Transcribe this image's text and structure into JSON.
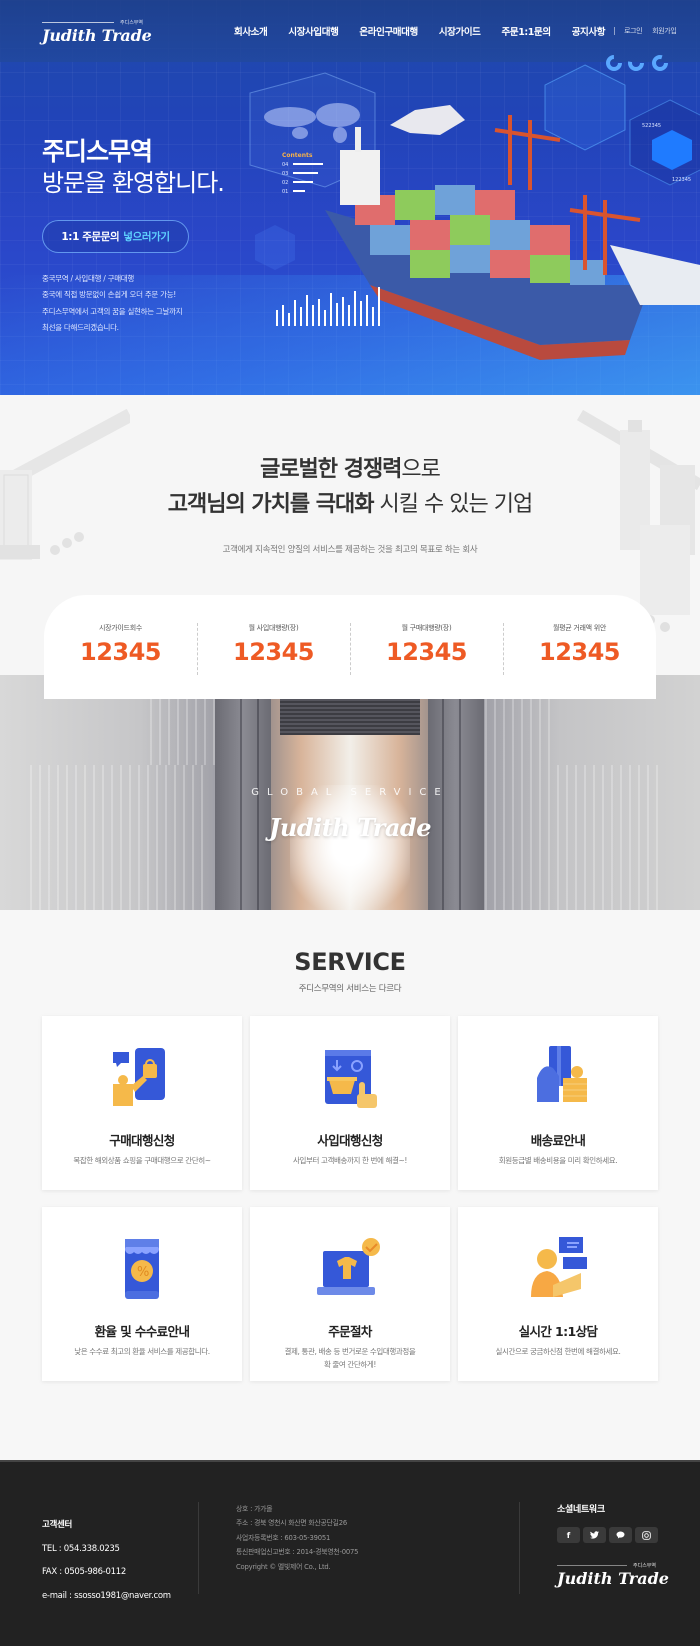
{
  "header": {
    "logo_text": "Judith Trade",
    "logo_sub": "주디스무역",
    "nav": [
      {
        "label": "회사소개"
      },
      {
        "label": "시장사입대행"
      },
      {
        "label": "온라인구매대행"
      },
      {
        "label": "시장가이드"
      },
      {
        "label": "주문1:1문의"
      },
      {
        "label": "공지사항"
      }
    ],
    "util": {
      "login": "로그인",
      "join": "회원가입"
    }
  },
  "hero": {
    "title_line1": "주디스무역",
    "title_line2": "방문을 환영합니다.",
    "cta_prefix": "1:1 주문문의",
    "cta_highlight": "넣으러가기",
    "desc": [
      "중국무역 / 사입대행 / 구매대행",
      "중국에 직접 방문없이 손쉽게 오더 주문 가능!",
      "주디스무역에서 고객의 꿈을 실현하는 그날까지",
      "최선을 다해드리겠습니다."
    ],
    "illustration": {
      "contents_label": "Contents",
      "contents_items": [
        "04",
        "03",
        "02",
        "01"
      ],
      "data_label_1": "522345",
      "data_label_2": "122345"
    }
  },
  "value": {
    "line1_bold": "글로벌한 경쟁력",
    "line1_rest": "으로",
    "line2_bold": "고객님의 가치를 극대화",
    "line2_rest": " 시킬 수 있는 기업",
    "subtitle": "고객에게 지속적인 양질의 서비스를 제공하는 것을 최고의 목표로 하는 회사"
  },
  "stats": [
    {
      "label": "시장가이드회수",
      "value": "12345"
    },
    {
      "label": "월 사입대행량(장)",
      "value": "12345"
    },
    {
      "label": "월 구매대행량(장)",
      "value": "12345"
    },
    {
      "label": "월평균 거래액 위안",
      "value": "12345"
    }
  ],
  "banner": {
    "subtitle": "GLOBAL SERVICE",
    "title": "Judith Trade"
  },
  "service": {
    "title": "SERVICE",
    "subtitle": "주디스무역의 서비스는 다르다",
    "cards": [
      {
        "icon": "shopping-phone-icon",
        "title": "구매대행신청",
        "desc": "복잡한 해외상품 쇼핑을 구매대행으로 간단히~"
      },
      {
        "icon": "purchase-basket-icon",
        "title": "사입대행신청",
        "desc": "사입부터 고객배송까지 한 번에 해결~!"
      },
      {
        "icon": "card-payment-icon",
        "title": "배송료안내",
        "desc": "회원등급별 배송비용을 미리 확인하세요."
      },
      {
        "icon": "exchange-rate-icon",
        "title": "환율 및 수수료안내",
        "desc": "낮은 수수료 최고의 환율 서비스를 제공합니다."
      },
      {
        "icon": "order-laptop-icon",
        "title": "주문절차",
        "desc": "결제, 통관, 배송 등 번거로운 수입대행과정을",
        "desc2": "확 줄여 간단하게!"
      },
      {
        "icon": "consulting-agent-icon",
        "title": "실시간 1:1상담",
        "desc": "실시간으로 궁금하신점 한번에 해결하세요."
      }
    ]
  },
  "footer": {
    "cs_title": "고객센터",
    "tel": "TEL : 054.338.0235",
    "fax": "FAX : 0505-986-0112",
    "email": "e-mail : ssosso1981@naver.com",
    "info": [
      "상호 : 가가몰",
      "주소 : 경북 영천시 화산면 화산공단길26",
      "사업자등록번호 : 603-05-39051",
      "통신판매업신고번호 : 2014-경북영천-0075",
      "Copyright © 멜빛제어 Co., Ltd."
    ],
    "social_title": "소셜네트워크",
    "socials": [
      {
        "name": "facebook",
        "glyph": "f"
      },
      {
        "name": "twitter",
        "glyph": "t"
      },
      {
        "name": "kakaotalk",
        "glyph": "●"
      },
      {
        "name": "instagram",
        "glyph": "◎"
      }
    ],
    "logo_text": "Judith Trade",
    "logo_sub": "주디스무역"
  },
  "colors": {
    "brand_blue": "#2a46c8",
    "accent_orange": "#ee5a24",
    "cta_highlight": "#5fd2ff",
    "footer_bg": "#222222"
  }
}
